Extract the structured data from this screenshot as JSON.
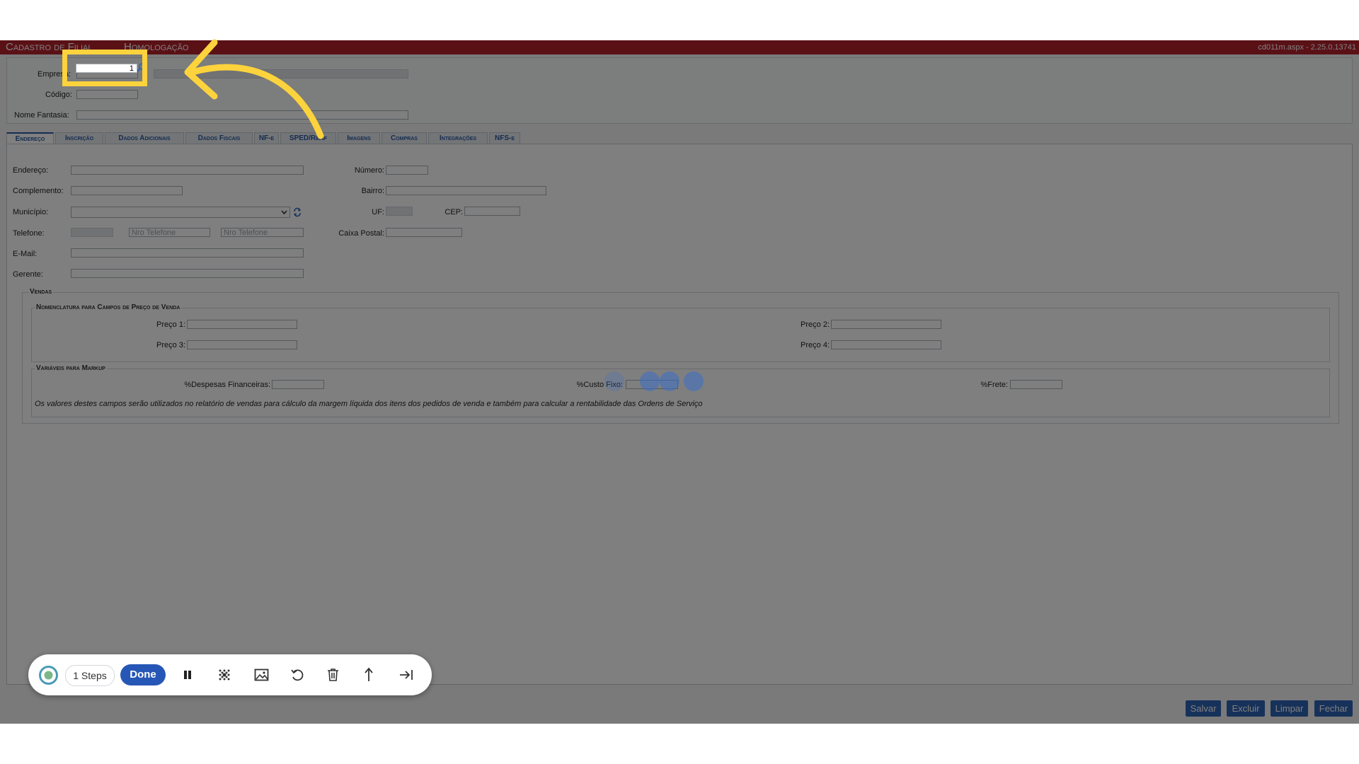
{
  "app": {
    "title": "Cadastro de Filial",
    "environment": "Homologação",
    "version": "cd011m.aspx - 2.25.0.13741"
  },
  "header_fields": {
    "empresa_label": "Empresa:",
    "empresa_value": "1",
    "codigo_label": "Código:",
    "nome_fantasia_label": "Nome Fantasia:"
  },
  "tabs": [
    "Endereço",
    "Inscrição",
    "Dados Adicionais",
    "Dados Fiscais",
    "NF-e",
    "SPED/Reinf",
    "Imagens",
    "Compras",
    "Integrações",
    "NFS-e"
  ],
  "address": {
    "endereco_label": "Endereço:",
    "numero_label": "Número:",
    "complemento_label": "Complemento:",
    "bairro_label": "Bairro:",
    "municipio_label": "Município:",
    "uf_label": "UF:",
    "cep_label": "CEP:",
    "telefone_label": "Telefone:",
    "telefone_placeholder_1": "Nro Telefone",
    "telefone_placeholder_2": "Nro Telefone",
    "caixa_postal_label": "Caixa Postal:",
    "email_label": "E-Mail:",
    "gerente_label": "Gerente:"
  },
  "vendas": {
    "legend": "Vendas",
    "nomenclatura_legend": "Nomenclatura para Campos de Preço de Venda",
    "preco1_label": "Preço 1:",
    "preco2_label": "Preço 2:",
    "preco3_label": "Preço 3:",
    "preco4_label": "Preço 4:",
    "markup_legend": "Variáveis para Markup",
    "despesas_label": "%Despesas Financeiras:",
    "custo_fixo_label": "%Custo Fixo:",
    "frete_label": "%Frete:",
    "note": "Os valores destes campos serão utilizados no relatório de vendas para cálculo da margem líquida dos itens dos pedidos de venda e também para calcular a rentabilidade das Ordens de Serviço"
  },
  "buttons": {
    "salvar": "Salvar",
    "excluir": "Excluir",
    "limpar": "Limpar",
    "fechar": "Fechar"
  },
  "recorder": {
    "steps": "1 Steps",
    "done": "Done"
  },
  "colors": {
    "title_bar": "#b5232c",
    "accent": "#2f65b5",
    "highlight": "#fcd33c"
  },
  "icons": [
    "search-icon",
    "refresh-icon",
    "chevron-down-icon",
    "pause-icon",
    "blur-icon",
    "image-icon",
    "undo-icon",
    "trash-icon",
    "share-icon",
    "skip-icon",
    "arrow-annotation"
  ]
}
